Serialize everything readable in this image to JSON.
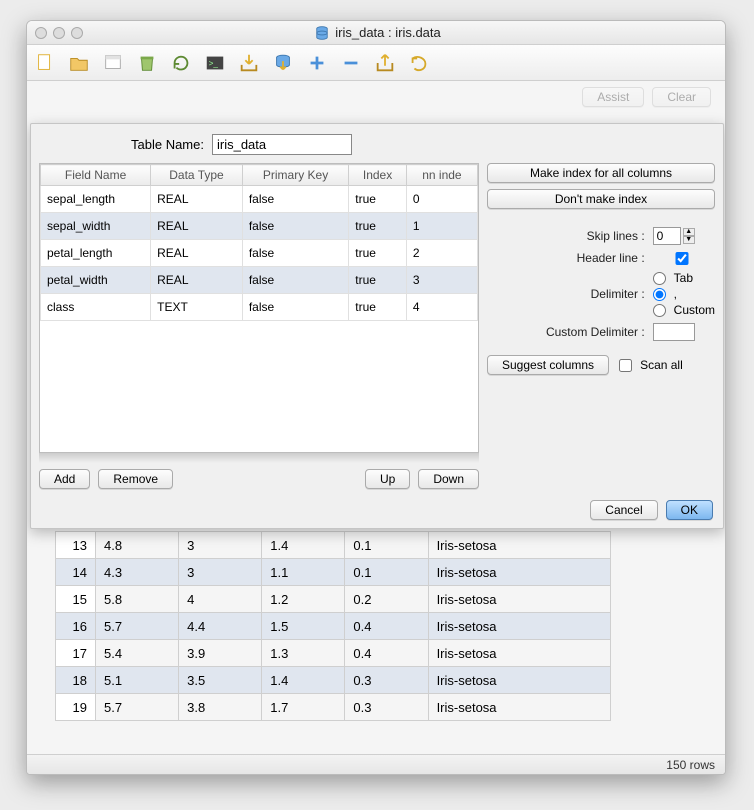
{
  "window": {
    "title": "iris_data : iris.data"
  },
  "toolbar_actions": {
    "assist": "Assist",
    "clear": "Clear"
  },
  "statusbar": {
    "rows": "150 rows"
  },
  "dialog": {
    "table_name_label": "Table Name:",
    "table_name_value": "iris_data",
    "col_headers": {
      "field": "Field Name",
      "type": "Data Type",
      "pk": "Primary Key",
      "index": "Index",
      "idxn": "nn inde"
    },
    "columns": [
      {
        "name": "sepal_length",
        "type": "REAL",
        "pk": "false",
        "index": "true",
        "n": "0"
      },
      {
        "name": "sepal_width",
        "type": "REAL",
        "pk": "false",
        "index": "true",
        "n": "1"
      },
      {
        "name": "petal_length",
        "type": "REAL",
        "pk": "false",
        "index": "true",
        "n": "2"
      },
      {
        "name": "petal_width",
        "type": "REAL",
        "pk": "false",
        "index": "true",
        "n": "3"
      },
      {
        "name": "class",
        "type": "TEXT",
        "pk": "false",
        "index": "true",
        "n": "4"
      }
    ],
    "btn_add": "Add",
    "btn_remove": "Remove",
    "btn_up": "Up",
    "btn_down": "Down",
    "btn_make_index": "Make index for all columns",
    "btn_no_index": "Don't make index",
    "skip_lines_label": "Skip lines :",
    "skip_lines_value": "0",
    "header_line_label": "Header line :",
    "header_line_checked": true,
    "delimiter_label": "Delimiter :",
    "delimiter_options": {
      "tab": "Tab",
      "comma": ",",
      "custom": "Custom"
    },
    "delimiter_value": "comma",
    "custom_delim_label": "Custom Delimiter :",
    "custom_delim_value": "",
    "btn_suggest": "Suggest columns",
    "scan_all_label": "Scan all",
    "scan_all_checked": false,
    "btn_cancel": "Cancel",
    "btn_ok": "OK"
  },
  "data_rows": [
    {
      "n": "13",
      "c1": "4.8",
      "c2": "3",
      "c3": "1.4",
      "c4": "0.1",
      "c5": "Iris-setosa"
    },
    {
      "n": "14",
      "c1": "4.3",
      "c2": "3",
      "c3": "1.1",
      "c4": "0.1",
      "c5": "Iris-setosa"
    },
    {
      "n": "15",
      "c1": "5.8",
      "c2": "4",
      "c3": "1.2",
      "c4": "0.2",
      "c5": "Iris-setosa"
    },
    {
      "n": "16",
      "c1": "5.7",
      "c2": "4.4",
      "c3": "1.5",
      "c4": "0.4",
      "c5": "Iris-setosa"
    },
    {
      "n": "17",
      "c1": "5.4",
      "c2": "3.9",
      "c3": "1.3",
      "c4": "0.4",
      "c5": "Iris-setosa"
    },
    {
      "n": "18",
      "c1": "5.1",
      "c2": "3.5",
      "c3": "1.4",
      "c4": "0.3",
      "c5": "Iris-setosa"
    },
    {
      "n": "19",
      "c1": "5.7",
      "c2": "3.8",
      "c3": "1.7",
      "c4": "0.3",
      "c5": "Iris-setosa"
    }
  ]
}
